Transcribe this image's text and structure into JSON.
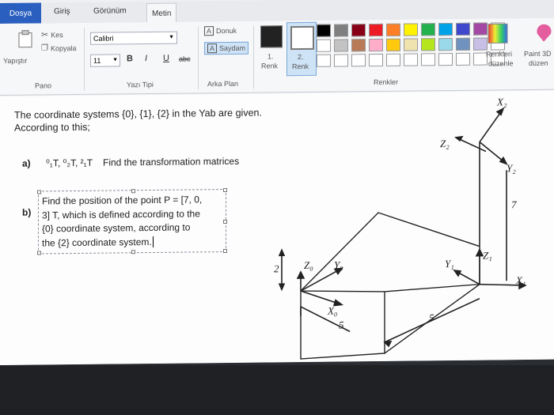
{
  "tabs": [
    "Dosya",
    "Giriş",
    "Görünüm",
    "Metin"
  ],
  "clipboard": {
    "paste_label": "Yapıştır",
    "cut_label": "Kes",
    "copy_label": "Kopyala",
    "group_label": "Pano"
  },
  "font": {
    "family": "Calibri",
    "size": "11",
    "bold": "B",
    "italic": "I",
    "underline": "U",
    "strike": "abc",
    "group_label": "Yazı Tipi"
  },
  "background": {
    "opaque_label": "Donuk",
    "transparent_label": "Saydam",
    "group_label": "Arka Plan"
  },
  "colors": {
    "color1_label": "1.",
    "color1_sub": "Renk",
    "color2_label": "2.",
    "color2_sub": "Renk",
    "edit_label_1": "Renkleri",
    "edit_label_2": "düzenle",
    "paint3d_1": "Paint 3D",
    "paint3d_2": "düzen",
    "group_label": "Renkler",
    "palette": [
      "#000000",
      "#7f7f7f",
      "#880015",
      "#ed1c24",
      "#ff7f27",
      "#fff200",
      "#22b14c",
      "#00a2e8",
      "#3f48cc",
      "#a349a4",
      "#ffffff",
      "#ffffff",
      "#c3c3c3",
      "#b97a57",
      "#ffaec9",
      "#ffc90e",
      "#efe4b0",
      "#b5e61d",
      "#99d9ea",
      "#7092be",
      "#c8bfe7",
      "#ffffff",
      "#ffffff",
      "#ffffff",
      "#ffffff",
      "#ffffff",
      "#ffffff",
      "#ffffff",
      "#ffffff",
      "#ffffff",
      "#ffffff",
      "#ffffff",
      "#ffffff"
    ]
  },
  "document": {
    "intro_1": "The coordinate systems {0}, {1}, {2} in the Yab are given.",
    "intro_2": "According to this;",
    "qa_label": "a)",
    "qa_matrices": "⁰₁T, ⁰₂T, ²₁T",
    "qa_text": "Find the transformation matrices",
    "qb_label": "b)",
    "qb_lines": [
      "Find the position of the point P = [7, 0,",
      "3] T, which is defined according to the",
      "{0} coordinate system, according to",
      "the {2} coordinate system."
    ]
  },
  "diagram": {
    "x2": "X₂",
    "z2": "Z₂",
    "y2": "Y₂",
    "x1": "X₁",
    "y1": "Y₁",
    "z1": "Z₁",
    "z0": "Z₀",
    "y0": "Y₀",
    "x0": "X₀",
    "dim_7": "7",
    "dim_5a": "5",
    "dim_5b": "5",
    "dim_2": "2"
  }
}
